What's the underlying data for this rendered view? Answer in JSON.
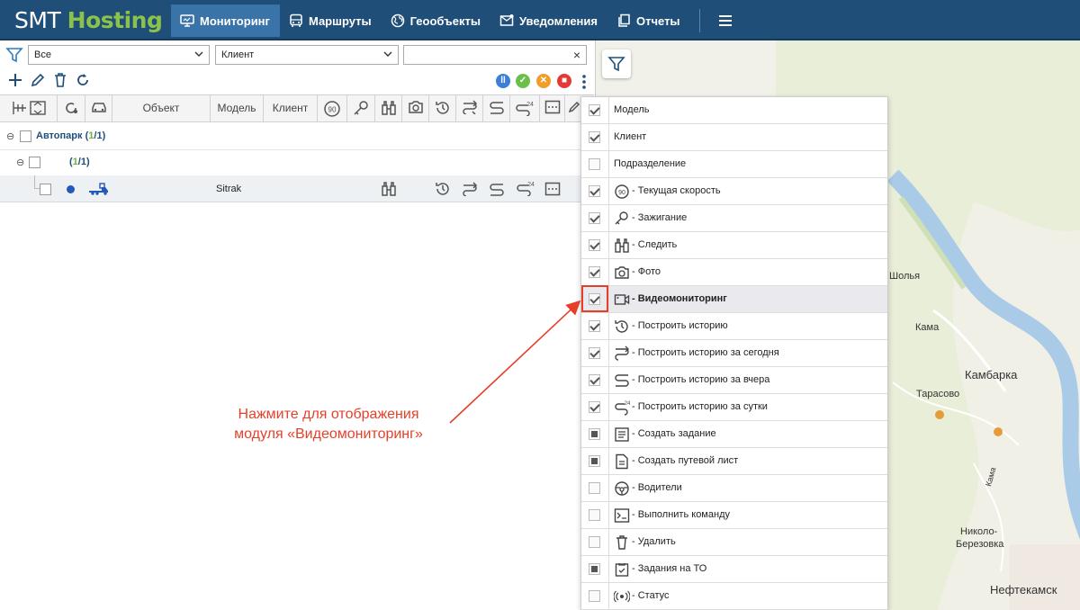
{
  "app": {
    "logo_a": "SMT",
    "logo_b": "Hosting"
  },
  "nav": {
    "items": [
      {
        "label": "Мониторинг"
      },
      {
        "label": "Маршруты"
      },
      {
        "label": "Геообъекты"
      },
      {
        "label": "Уведомления"
      },
      {
        "label": "Отчеты"
      }
    ]
  },
  "filter": {
    "group_value": "Все",
    "client_value": "Клиент",
    "search_value": "",
    "clear_label": "×"
  },
  "table": {
    "columns": {
      "object": "Объект",
      "model": "Модель",
      "client": "Клиент"
    },
    "speed_badge": "90",
    "group_root": {
      "label": "Автопарк",
      "count_open": "(",
      "count_a": "1",
      "slash": "/",
      "count_b": "1",
      "count_close": ")"
    },
    "group_sub": {
      "count_open": "(",
      "count_a": "1",
      "slash": "/",
      "count_b": "1",
      "count_close": ")"
    },
    "vehicle_row": {
      "model": "Sitrak"
    },
    "history_badge": "24"
  },
  "menu": {
    "items": [
      {
        "label": "Модель",
        "state": "on"
      },
      {
        "label": "Клиент",
        "state": "on"
      },
      {
        "label": "Подразделение",
        "state": "off"
      },
      {
        "label": "- Текущая скорость",
        "state": "on",
        "icon": "speed-icon"
      },
      {
        "label": "- Зажигание",
        "state": "on",
        "icon": "key-icon"
      },
      {
        "label": "- Следить",
        "state": "on",
        "icon": "binoculars-icon"
      },
      {
        "label": "- Фото",
        "state": "on",
        "icon": "camera-icon"
      },
      {
        "label": "- Видеомониторинг",
        "state": "on",
        "icon": "video-camera-icon",
        "highlight": true
      },
      {
        "label": "- Построить историю",
        "state": "on",
        "icon": "history-icon"
      },
      {
        "label": "- Построить историю за сегодня",
        "state": "on",
        "icon": "route-today-icon"
      },
      {
        "label": "- Построить историю за вчера",
        "state": "on",
        "icon": "route-yesterday-icon"
      },
      {
        "label": "- Построить историю за сутки",
        "state": "on",
        "icon": "route-24h-icon"
      },
      {
        "label": "- Создать задание",
        "state": "part",
        "icon": "task-icon"
      },
      {
        "label": "- Создать путевой лист",
        "state": "part",
        "icon": "waybill-icon"
      },
      {
        "label": "- Водители",
        "state": "off",
        "icon": "steering-wheel-icon"
      },
      {
        "label": "- Выполнить команду",
        "state": "off",
        "icon": "terminal-icon"
      },
      {
        "label": "- Удалить",
        "state": "off",
        "icon": "trash-icon"
      },
      {
        "label": "- Задания на ТО",
        "state": "part",
        "icon": "maintenance-icon"
      },
      {
        "label": "- Статус",
        "state": "off",
        "icon": "status-icon"
      }
    ]
  },
  "annotation": {
    "line1": "Нажмите для отображения",
    "line2": "модуля «Видеомониторинг»"
  },
  "map": {
    "labels": [
      "Шолья",
      "Кама",
      "Камбарка",
      "Тарасово",
      "Кама",
      "Николо-",
      "Березовка",
      "Нефтекамск"
    ]
  },
  "colors": {
    "nav_bg": "#1f4e79",
    "nav_active": "#3a73a8",
    "accent_green": "#8bc34a",
    "annotation": "#e53f2a"
  }
}
